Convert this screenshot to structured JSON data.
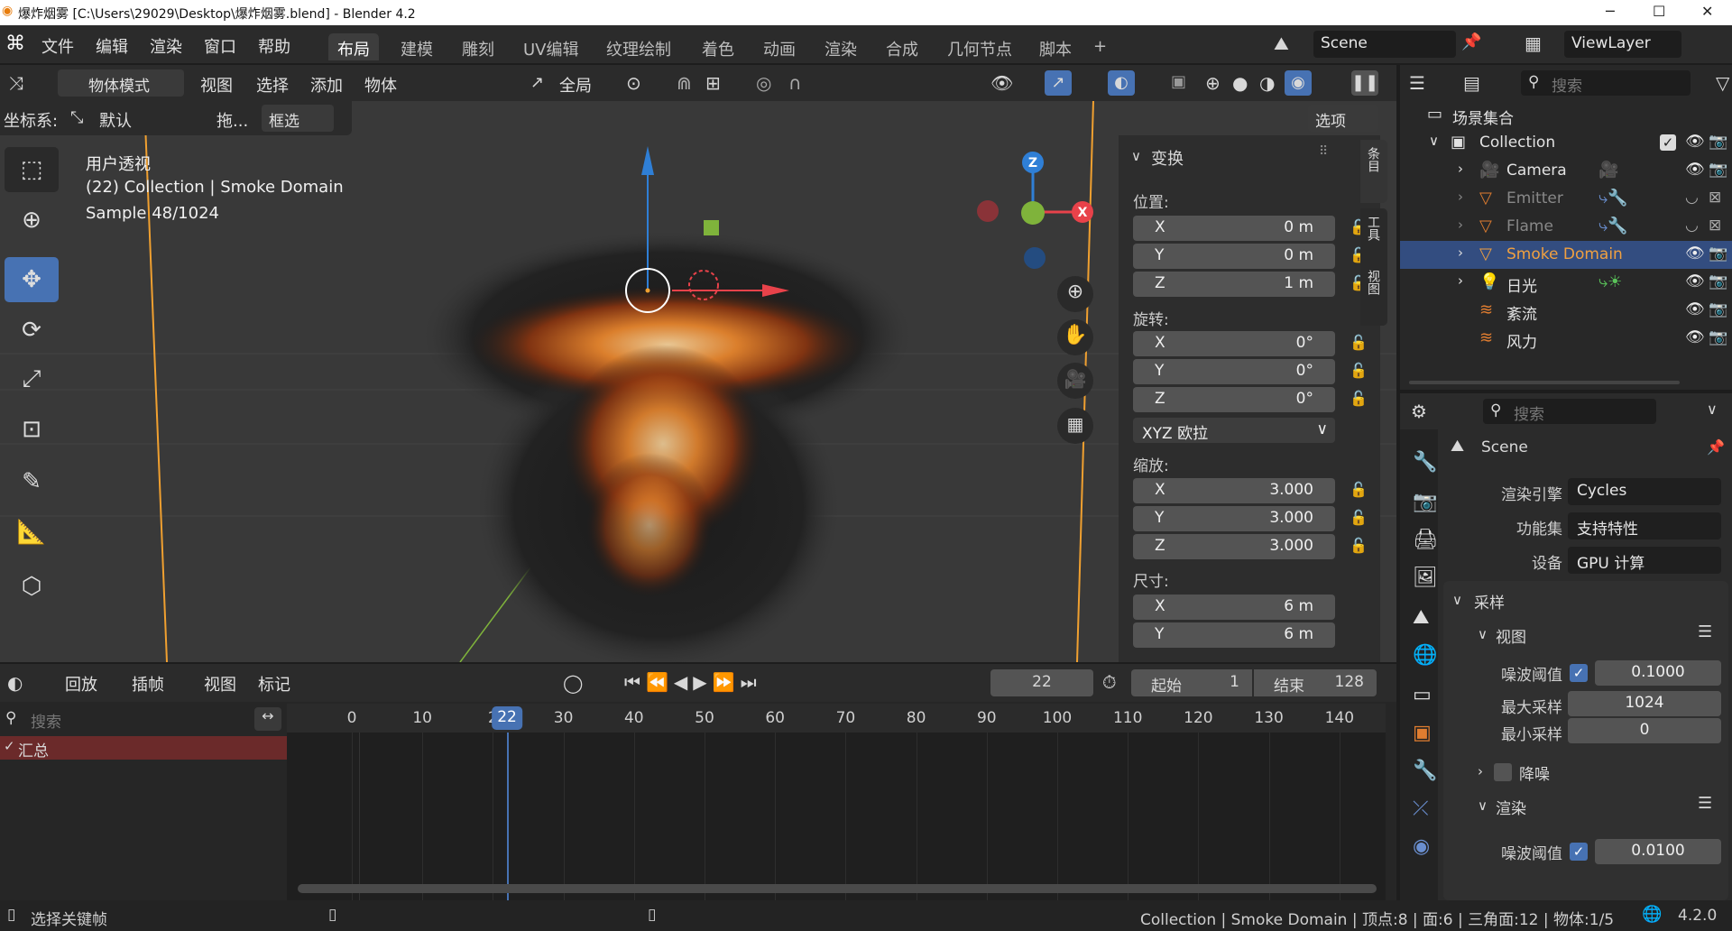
{
  "window": {
    "title": "爆炸烟雾 [C:\\Users\\29029\\Desktop\\爆炸烟雾.blend] - Blender 4.2",
    "minimize": "─",
    "maximize": "☐",
    "close": "✕"
  },
  "menubar": {
    "menus": [
      "文件",
      "编辑",
      "渲染",
      "窗口",
      "帮助"
    ],
    "workspaces": [
      "布局",
      "建模",
      "雕刻",
      "UV编辑",
      "纹理绘制",
      "着色",
      "动画",
      "渲染",
      "合成",
      "几何节点",
      "脚本"
    ],
    "active_workspace": "布局",
    "add_workspace": "+",
    "scene": "Scene",
    "view_layer": "ViewLayer"
  },
  "viewport_header": {
    "mode": "物体模式",
    "menus": [
      "视图",
      "选择",
      "添加",
      "物体"
    ],
    "transform_orientation": "全局",
    "coord_label": "坐标系:",
    "coord_value": "默认",
    "drag_label": "拖...",
    "select_box": "框选",
    "options": "选项"
  },
  "viewport_overlay": {
    "view_name": "用户透视",
    "collection_info": "(22) Collection | Smoke Domain",
    "sample": "Sample 48/1024"
  },
  "gizmo": {
    "x": "X",
    "y": "Y",
    "z": "Z"
  },
  "sidebar_tabs": [
    "条目",
    "工具",
    "视图"
  ],
  "transform_panel": {
    "title": "变换",
    "location_label": "位置:",
    "location": [
      {
        "axis": "X",
        "value": "0 m"
      },
      {
        "axis": "Y",
        "value": "0 m"
      },
      {
        "axis": "Z",
        "value": "1 m"
      }
    ],
    "rotation_label": "旋转:",
    "rotation": [
      {
        "axis": "X",
        "value": "0°"
      },
      {
        "axis": "Y",
        "value": "0°"
      },
      {
        "axis": "Z",
        "value": "0°"
      }
    ],
    "rotation_mode": "XYZ 欧拉",
    "scale_label": "缩放:",
    "scale": [
      {
        "axis": "X",
        "value": "3.000"
      },
      {
        "axis": "Y",
        "value": "3.000"
      },
      {
        "axis": "Z",
        "value": "3.000"
      }
    ],
    "dimensions_label": "尺寸:",
    "dimensions": [
      {
        "axis": "X",
        "value": "6 m"
      },
      {
        "axis": "Y",
        "value": "6 m"
      }
    ]
  },
  "timeline": {
    "menus": [
      "回放",
      "插帧",
      "视图",
      "标记"
    ],
    "current_frame": "22",
    "start_label": "起始",
    "start": "1",
    "end_label": "结束",
    "end": "128",
    "search_placeholder": "搜索",
    "summary": "汇总",
    "ticks": [
      "0",
      "10",
      "2",
      "30",
      "40",
      "50",
      "60",
      "70",
      "80",
      "90",
      "100",
      "110",
      "120",
      "130",
      "140"
    ],
    "playhead_label": "22"
  },
  "outliner": {
    "search_placeholder": "搜索",
    "scene_collection": "场景集合",
    "collection": "Collection",
    "items": [
      {
        "name": "Camera",
        "icon": "camera-icon",
        "dim": false
      },
      {
        "name": "Emitter",
        "icon": "mesh-icon",
        "dim": true
      },
      {
        "name": "Flame",
        "icon": "mesh-icon",
        "dim": true
      },
      {
        "name": "Smoke Domain",
        "icon": "mesh-icon",
        "dim": false,
        "selected": true
      },
      {
        "name": "日光",
        "icon": "light-icon",
        "dim": false
      },
      {
        "name": "紊流",
        "icon": "force-field-icon",
        "dim": false
      },
      {
        "name": "风力",
        "icon": "force-field-icon",
        "dim": false
      }
    ]
  },
  "properties": {
    "search_placeholder": "搜索",
    "scene_name": "Scene",
    "render_engine_label": "渲染引擎",
    "render_engine": "Cycles",
    "feature_set_label": "功能集",
    "feature_set": "支持特性",
    "device_label": "设备",
    "device": "GPU 计算",
    "sampling_title": "采样",
    "viewport_title": "视图",
    "noise_threshold_label": "噪波阈值",
    "viewport_noise_threshold": "0.1000",
    "max_samples_label": "最大采样",
    "viewport_max_samples": "1024",
    "min_samples_label": "最小采样",
    "viewport_min_samples": "0",
    "denoise_label": "降噪",
    "render_title": "渲染",
    "render_noise_threshold": "0.0100"
  },
  "statusbar": {
    "left_hint": "选择关键帧",
    "info": "Collection | Smoke Domain | 顶点:8 | 面:6 | 三角面:12 | 物体:1/5",
    "version": "4.2.0"
  },
  "colors": {
    "accent": "#4772b3",
    "selected_row": "#334d80",
    "summary_row": "#6b2a2a",
    "x_axis": "#e8424a",
    "y_axis": "#7fb33b",
    "z_axis": "#2f7fd6",
    "camera_line": "#f0a030"
  }
}
